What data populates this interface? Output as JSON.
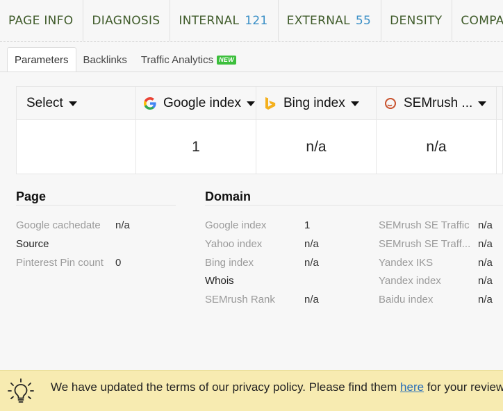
{
  "topnav": {
    "tabs": [
      {
        "label": "PAGE INFO",
        "count": ""
      },
      {
        "label": "DIAGNOSIS",
        "count": ""
      },
      {
        "label": "INTERNAL",
        "count": "121"
      },
      {
        "label": "EXTERNAL",
        "count": "55"
      },
      {
        "label": "DENSITY",
        "count": ""
      },
      {
        "label": "COMPARE URL",
        "count": ""
      }
    ]
  },
  "subtabs": {
    "parameters": "Parameters",
    "backlinks": "Backlinks",
    "traffic": "Traffic Analytics",
    "new_badge": "NEW"
  },
  "metrics": {
    "headers": {
      "select": "Select",
      "google": "Google index",
      "bing": "Bing index",
      "semrush": "SEMrush ..."
    },
    "values": {
      "select": "",
      "google": "1",
      "bing": "n/a",
      "semrush": "n/a"
    }
  },
  "page_section": {
    "title": "Page",
    "rows": [
      {
        "label": "Google cachedate",
        "value": "n/a"
      },
      {
        "label": "Source",
        "value": ""
      },
      {
        "label": "Pinterest Pin count",
        "value": "0"
      }
    ]
  },
  "domain_section": {
    "title": "Domain",
    "col1": [
      {
        "label": "Google index",
        "value": "1"
      },
      {
        "label": "Yahoo index",
        "value": "n/a"
      },
      {
        "label": "Bing index",
        "value": "n/a"
      },
      {
        "label": "Whois",
        "value": ""
      },
      {
        "label": "SEMrush Rank",
        "value": "n/a"
      }
    ],
    "col2": [
      {
        "label": "SEMrush SE Traffic",
        "value": "n/a"
      },
      {
        "label": "SEMrush SE Traff...",
        "value": "n/a"
      },
      {
        "label": "Yandex IKS",
        "value": "n/a"
      },
      {
        "label": "Yandex index",
        "value": "n/a"
      },
      {
        "label": "Baidu index",
        "value": "n/a"
      }
    ]
  },
  "privacy": {
    "before": "We have updated the terms of our privacy policy. Please find them ",
    "link": "here",
    "after": " for your review"
  }
}
